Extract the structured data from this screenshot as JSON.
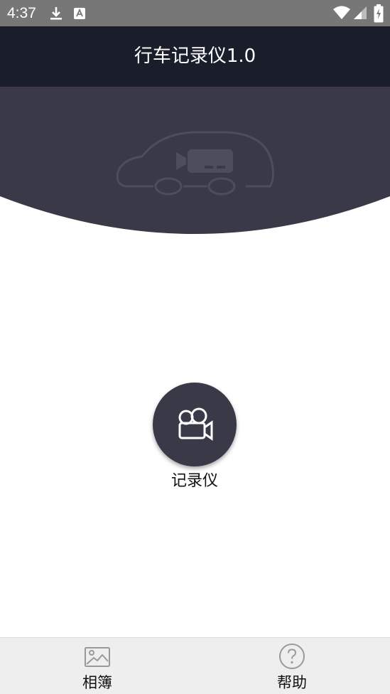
{
  "status_bar": {
    "time": "4:37",
    "icons": [
      "download-icon",
      "notification-a-icon",
      "wifi-icon",
      "signal-icon",
      "battery-charging-icon"
    ]
  },
  "app_bar": {
    "title": "行车记录仪1.0"
  },
  "header": {
    "illustration": "car-camera-illustration"
  },
  "main": {
    "record_button": {
      "icon": "video-camera-icon",
      "label": "记录仪"
    }
  },
  "bottom_nav": {
    "items": [
      {
        "label": "相簿",
        "icon": "image-icon"
      },
      {
        "label": "帮助",
        "icon": "help-circle-icon"
      }
    ]
  },
  "colors": {
    "status_bar": "#777777",
    "app_bar": "#1a1e2b",
    "header_arc": "#3a3947",
    "record_button": "#3a3947",
    "bottom_nav": "#eeeeee"
  }
}
